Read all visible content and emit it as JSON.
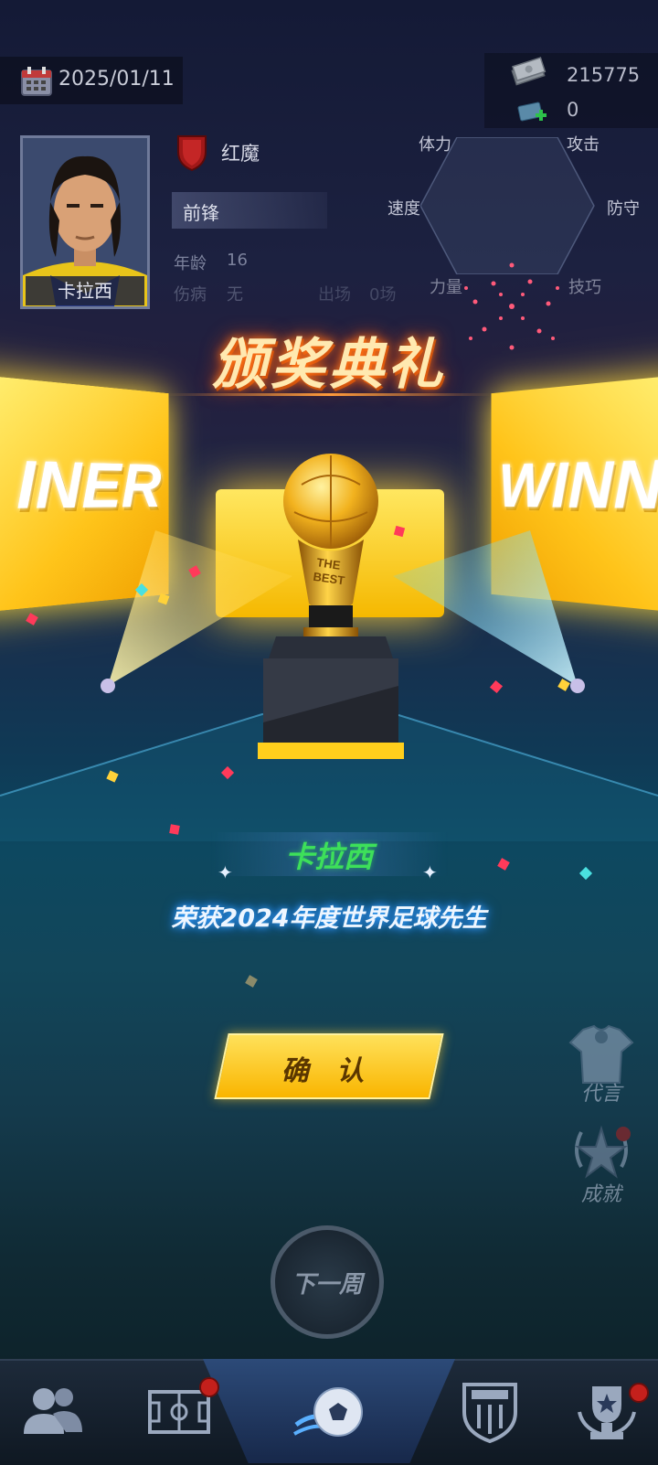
{
  "header": {
    "date": "2025/01/11",
    "cash": "215775",
    "gems": "0"
  },
  "player": {
    "name": "卡拉西",
    "team": "红魔",
    "position": "前锋",
    "age_label": "年龄",
    "age_value": "16",
    "injury_label": "伤病",
    "injury_value": "无",
    "appearances_label": "出场",
    "appearances_value": "0场"
  },
  "radar": {
    "labels": [
      "体力",
      "攻击",
      "速度",
      "防守",
      "力量",
      "技巧"
    ]
  },
  "ceremony": {
    "title": "颁奖典礼",
    "screen_left_text": "INER",
    "screen_right_text": "WINN",
    "trophy_engraving": "THE BEST",
    "winner_name": "卡拉西",
    "award_text": "荣获2024年度世界足球先生",
    "confirm_label": "确 认"
  },
  "side_menu": {
    "endorsement_label": "代言",
    "achievement_label": "成就"
  },
  "next_week_label": "下一周",
  "nav": {
    "items": [
      "players-icon",
      "pitch-icon",
      "football-icon",
      "club-badge-icon",
      "trophy-icon"
    ]
  },
  "colors": {
    "winner_name": "#3de05a",
    "confirm_button": "#f9b500",
    "title_glow": "#ff7a1a"
  }
}
